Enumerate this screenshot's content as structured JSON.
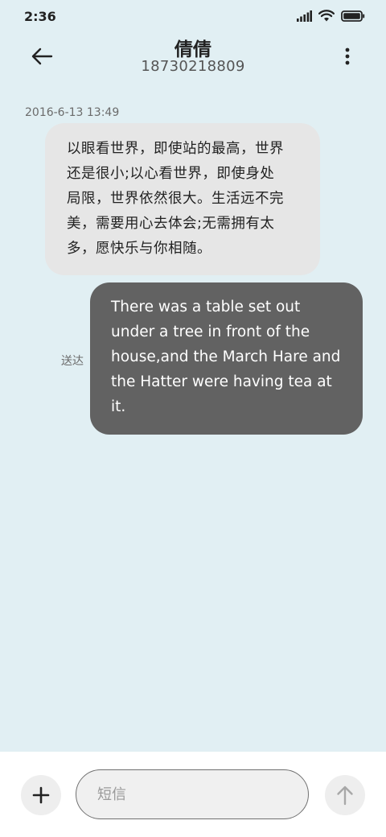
{
  "status_bar": {
    "time": "2:36",
    "icons": [
      "signal-icon",
      "wifi-icon",
      "battery-icon"
    ]
  },
  "header": {
    "contact_name": "倩倩",
    "contact_number": "18730218809",
    "back_icon": "arrow-left-icon",
    "more_icon": "more-vertical-icon"
  },
  "conversation": {
    "timestamp": "2016-6-13 13:49",
    "messages": [
      {
        "direction": "incoming",
        "lines": [
          "以眼看世界，即使站的最高，世界",
          "还是很小;以心看世界，即使身处",
          "局限，世界依然很大。生活远不完",
          "美，需要用心去体会;无需拥有太",
          "多，愿快乐与你相随。"
        ]
      },
      {
        "direction": "outgoing",
        "status": "送达",
        "lines": [
          "There was a table set out",
          "under a tree in front of the",
          "house,and the March Hare and",
          "the Hatter were having tea at",
          "it."
        ]
      }
    ]
  },
  "composer": {
    "attach_icon": "plus-icon",
    "input_placeholder": "短信",
    "input_value": "",
    "send_icon": "arrow-up-icon"
  },
  "colors": {
    "background": "#e1eff3",
    "incoming_bubble": "#e6e6e6",
    "outgoing_bubble": "#626262",
    "composer_background": "#ffffff"
  }
}
